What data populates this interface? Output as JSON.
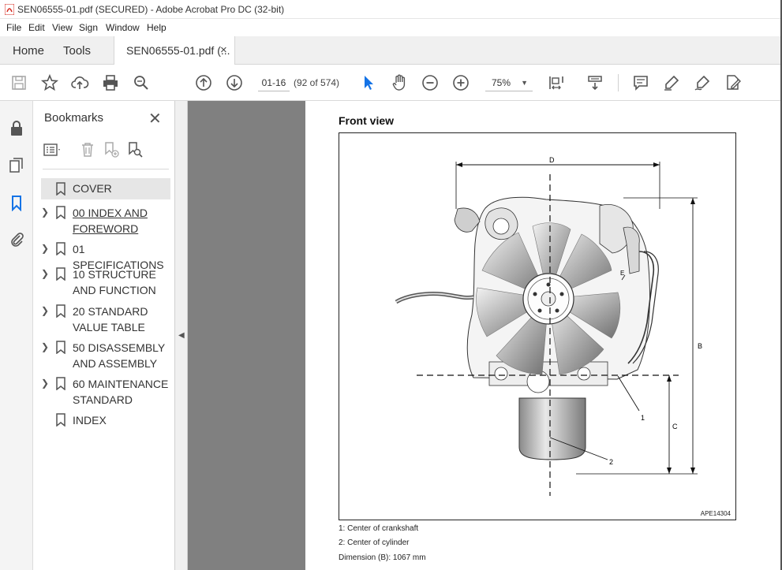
{
  "window": {
    "title": "SEN06555-01.pdf (SECURED) - Adobe Acrobat Pro DC (32-bit)"
  },
  "menubar": {
    "items": [
      "File",
      "Edit",
      "View",
      "Sign",
      "Window",
      "Help"
    ]
  },
  "tabs": {
    "home": "Home",
    "tools": "Tools",
    "document": "SEN06555-01.pdf (..."
  },
  "toolbar": {
    "page_input": "01-16",
    "page_count": "(92 of 574)",
    "zoom": "75%"
  },
  "bookmarks": {
    "title": "Bookmarks",
    "items": [
      {
        "label": "COVER",
        "expandable": false,
        "selected": true
      },
      {
        "label": "00 INDEX AND FOREWORD",
        "expandable": true,
        "selected": false
      },
      {
        "label": "01 SPECIFICATIONS",
        "expandable": true,
        "selected": false
      },
      {
        "label": "10 STRUCTURE AND FUNCTION",
        "expandable": true,
        "selected": false
      },
      {
        "label": "20 STANDARD VALUE TABLE",
        "expandable": true,
        "selected": false
      },
      {
        "label": "50 DISASSEMBLY AND ASSEMBLY",
        "expandable": true,
        "selected": false
      },
      {
        "label": "60 MAINTENANCE STANDARD",
        "expandable": true,
        "selected": false
      },
      {
        "label": "INDEX",
        "expandable": false,
        "selected": false
      }
    ]
  },
  "document": {
    "heading": "Front view",
    "figure": {
      "labels": {
        "d": "D",
        "b": "B",
        "c": "C",
        "e": "E",
        "one": "1",
        "two": "2"
      },
      "code": "APE14304"
    },
    "captions": [
      "1: Center of crankshaft",
      "2: Center of cylinder",
      "Dimension (B): 1067 mm"
    ]
  },
  "colors": {
    "accent_blue": "#1473e6",
    "viewer_gray": "#808080",
    "pdf_red": "#d6281e"
  }
}
